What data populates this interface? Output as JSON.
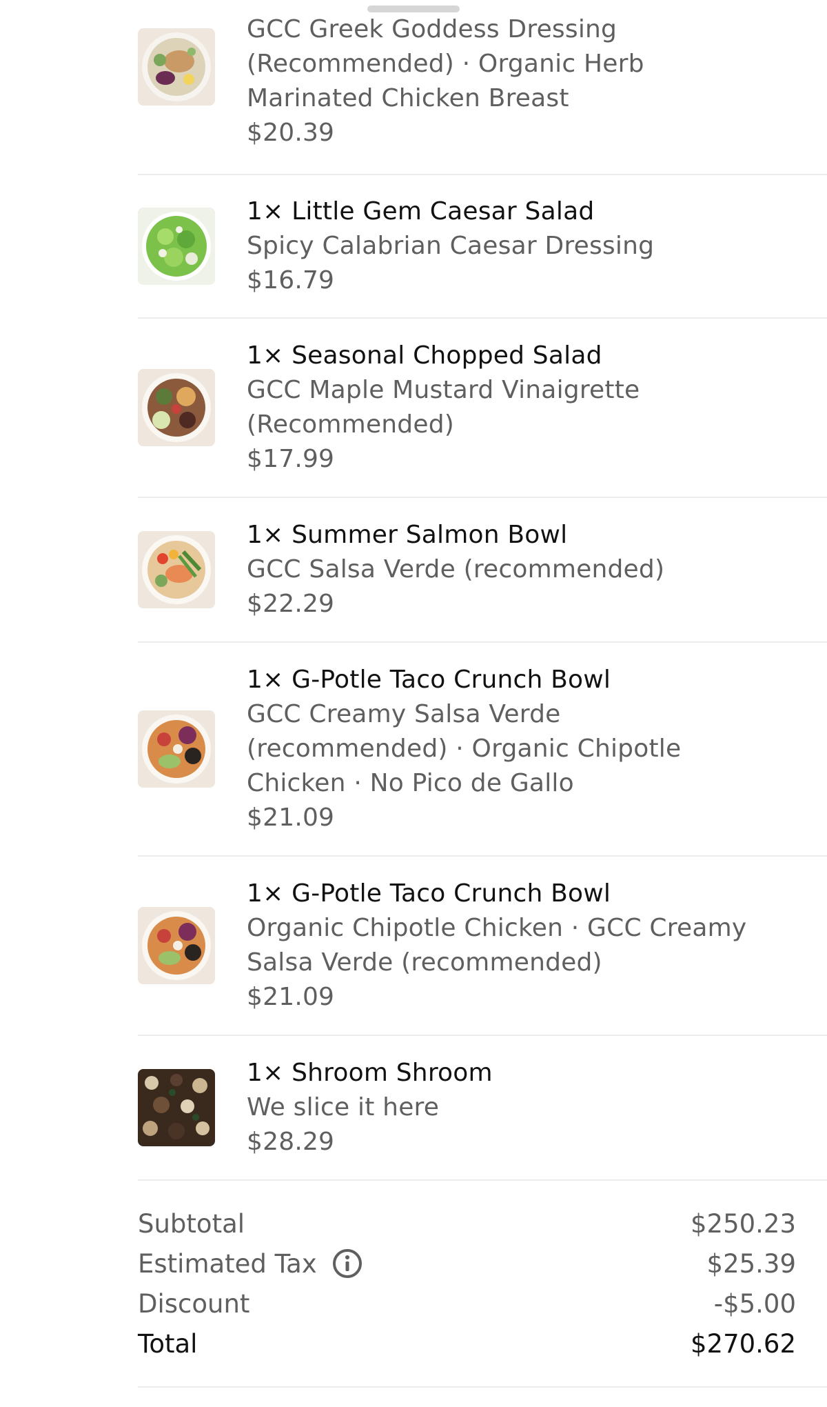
{
  "items": [
    {
      "title": "",
      "options_lines": [
        "GCC Greek Goddess Dressing",
        "(Recommended) · Organic Herb",
        "Marinated Chicken Breast"
      ],
      "price": "$20.39",
      "thumb": "greek-chicken-bowl-icon"
    },
    {
      "title": "1× Little Gem Caesar Salad",
      "options_lines": [
        "Spicy Calabrian Caesar Dressing"
      ],
      "price": "$16.79",
      "thumb": "caesar-salad-icon"
    },
    {
      "title": "1× Seasonal Chopped Salad",
      "options_lines": [
        "GCC Maple Mustard Vinaigrette",
        "(Recommended)"
      ],
      "price": "$17.99",
      "thumb": "chopped-salad-icon"
    },
    {
      "title": "1× Summer Salmon Bowl",
      "options_lines": [
        "GCC Salsa Verde (recommended)"
      ],
      "price": "$22.29",
      "thumb": "salmon-bowl-icon"
    },
    {
      "title": "1× G-Potle Taco Crunch Bowl",
      "options_lines": [
        "GCC Creamy Salsa Verde",
        "(recommended) · Organic Chipotle",
        "Chicken · No Pico de Gallo"
      ],
      "price": "$21.09",
      "thumb": "taco-bowl-icon"
    },
    {
      "title": "1× G-Potle Taco Crunch Bowl",
      "options_lines": [
        "Organic Chipotle Chicken · GCC Creamy",
        "Salsa Verde (recommended)"
      ],
      "price": "$21.09",
      "thumb": "taco-bowl-icon"
    },
    {
      "title": "1× Shroom Shroom",
      "options_lines": [
        "We slice it here"
      ],
      "price": "$28.29",
      "thumb": "mushroom-pizza-icon"
    }
  ],
  "summary": {
    "subtotal_label": "Subtotal",
    "subtotal_value": "$250.23",
    "tax_label": "Estimated Tax",
    "tax_value": "$25.39",
    "discount_label": "Discount",
    "discount_value": "-$5.00",
    "total_label": "Total",
    "total_value": "$270.62"
  },
  "colors": {
    "primary_text": "#111111",
    "secondary_text": "#5f5f5f",
    "divider": "#ececec"
  }
}
